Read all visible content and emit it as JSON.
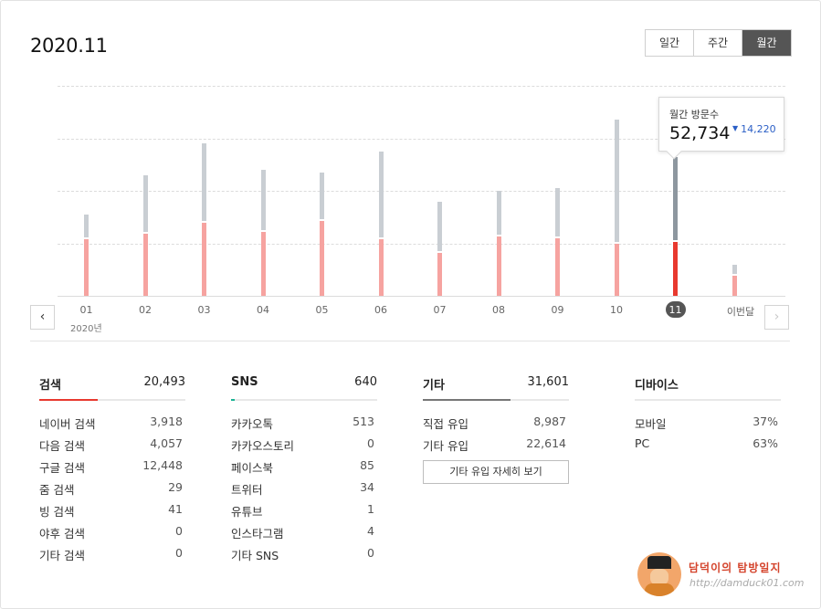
{
  "header": {
    "title": "2020.11"
  },
  "period_tabs": [
    {
      "label": "일간",
      "active": false
    },
    {
      "label": "주간",
      "active": false
    },
    {
      "label": "월간",
      "active": true
    }
  ],
  "chart_data": {
    "type": "bar",
    "categories": [
      "01",
      "02",
      "03",
      "04",
      "05",
      "06",
      "07",
      "08",
      "09",
      "10",
      "11",
      "이번달"
    ],
    "year_label": "2020년",
    "current_index": 10,
    "series": [
      {
        "name": "stacked_total",
        "values": [
          31000,
          46000,
          58000,
          48000,
          47000,
          55000,
          36000,
          40000,
          41000,
          67000,
          52734,
          12000
        ]
      },
      {
        "name": "search_part",
        "values": [
          21500,
          23500,
          28000,
          24500,
          28500,
          21500,
          16500,
          22500,
          22000,
          20000,
          20493,
          7500
        ]
      }
    ],
    "ylim": [
      0,
      80000
    ],
    "grid": true,
    "tooltip": {
      "label": "월간 방문수",
      "value": "52,734",
      "diff": "14,220",
      "diff_direction": "down"
    }
  },
  "colors": {
    "search": "#e8392f",
    "sns": "#1ab394",
    "other": "#777777",
    "bar_total": "#c9ced3",
    "bar_search": "#f6a3a0"
  },
  "stats": {
    "search": {
      "title": "검색",
      "total": "20,493",
      "ratio": 0.4,
      "items": [
        {
          "label": "네이버 검색",
          "value": "3,918"
        },
        {
          "label": "다음 검색",
          "value": "4,057"
        },
        {
          "label": "구글 검색",
          "value": "12,448"
        },
        {
          "label": "줌 검색",
          "value": "29"
        },
        {
          "label": "빙 검색",
          "value": "41"
        },
        {
          "label": "야후 검색",
          "value": "0"
        },
        {
          "label": "기타 검색",
          "value": "0"
        }
      ]
    },
    "sns": {
      "title": "SNS",
      "total": "640",
      "ratio": 0.012,
      "items": [
        {
          "label": "카카오톡",
          "value": "513"
        },
        {
          "label": "카카오스토리",
          "value": "0"
        },
        {
          "label": "페이스북",
          "value": "85"
        },
        {
          "label": "트위터",
          "value": "34"
        },
        {
          "label": "유튜브",
          "value": "1"
        },
        {
          "label": "인스타그램",
          "value": "4"
        },
        {
          "label": "기타 SNS",
          "value": "0"
        }
      ]
    },
    "other": {
      "title": "기타",
      "total": "31,601",
      "ratio": 0.6,
      "items": [
        {
          "label": "직접 유입",
          "value": "8,987"
        },
        {
          "label": "기타 유입",
          "value": "22,614"
        }
      ],
      "more_label": "기타 유입 자세히 보기"
    },
    "device": {
      "title": "디바이스",
      "items": [
        {
          "label": "모바일",
          "value": "37%"
        },
        {
          "label": "PC",
          "value": "63%"
        }
      ]
    }
  },
  "watermark": {
    "text": "담덕이의 탐방일지",
    "url": "http://damduck01.com"
  },
  "icons": {
    "prev": "chevron-left-icon",
    "next": "chevron-right-icon"
  }
}
